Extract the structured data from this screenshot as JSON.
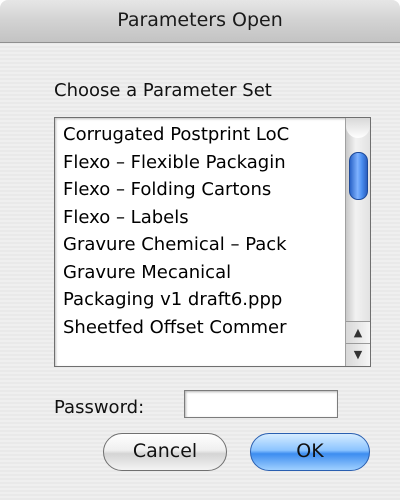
{
  "window": {
    "title": "Parameters Open"
  },
  "list": {
    "label": "Choose a Parameter Set",
    "items": [
      "Corrugated Postprint LoC",
      "Flexo – Flexible Packagin",
      "Flexo – Folding Cartons",
      "Flexo – Labels",
      "Gravure Chemical – Pack",
      "Gravure Mecanical",
      "Packaging v1 draft6.ppp",
      "Sheetfed Offset Commer"
    ]
  },
  "password": {
    "label": "Password:",
    "value": ""
  },
  "buttons": {
    "cancel": "Cancel",
    "ok": "OK"
  },
  "colors": {
    "accent": "#4a8ef0"
  }
}
